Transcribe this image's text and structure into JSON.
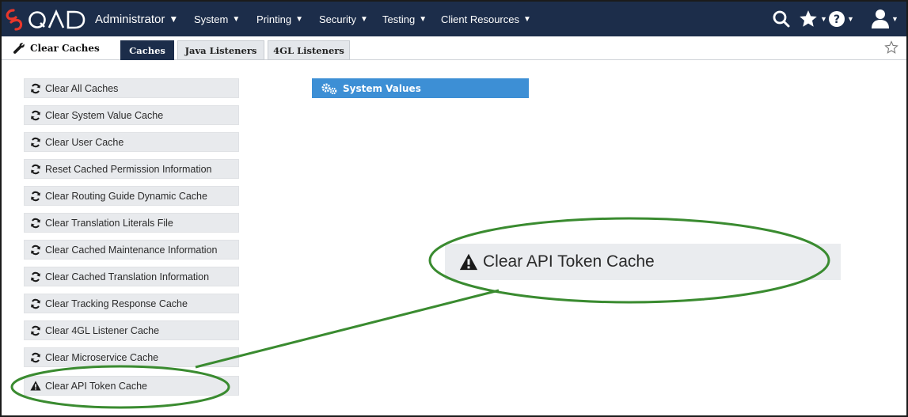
{
  "app": {
    "brand": "QAD",
    "brand_color": "#e8372b",
    "nav_bg": "#1c2d4a",
    "accent": "#3d8fd5",
    "annotation_color": "#3a8b30"
  },
  "topnav": {
    "role_menu": "Administrator",
    "menus": [
      "System",
      "Printing",
      "Security",
      "Testing",
      "Client Resources"
    ],
    "icons": [
      "search-icon",
      "favorites-star-icon",
      "help-icon",
      "user-icon"
    ]
  },
  "page": {
    "title": "Clear Caches",
    "tabs": [
      "Caches",
      "Java Listeners",
      "4GL Listeners"
    ],
    "active_tab": "Caches"
  },
  "actions": [
    {
      "label": "Clear All Caches",
      "icon": "refresh-icon"
    },
    {
      "label": "Clear System Value Cache",
      "icon": "refresh-icon"
    },
    {
      "label": "Clear User Cache",
      "icon": "refresh-icon"
    },
    {
      "label": "Reset Cached Permission Information",
      "icon": "refresh-icon"
    },
    {
      "label": "Clear Routing Guide Dynamic Cache",
      "icon": "refresh-icon"
    },
    {
      "label": "Clear Translation Literals File",
      "icon": "refresh-icon"
    },
    {
      "label": "Clear Cached Maintenance Information",
      "icon": "refresh-icon"
    },
    {
      "label": "Clear Cached Translation Information",
      "icon": "refresh-icon"
    },
    {
      "label": "Clear Tracking Response Cache",
      "icon": "refresh-icon"
    },
    {
      "label": "Clear 4GL Listener Cache",
      "icon": "refresh-icon"
    },
    {
      "label": "Clear Microservice Cache",
      "icon": "refresh-icon"
    },
    {
      "label": "Clear API Token Cache",
      "icon": "warning-icon"
    }
  ],
  "system_values": {
    "label": "System Values",
    "icon": "gears-icon"
  },
  "callout": {
    "label": "Clear API Token Cache",
    "icon": "warning-icon"
  }
}
